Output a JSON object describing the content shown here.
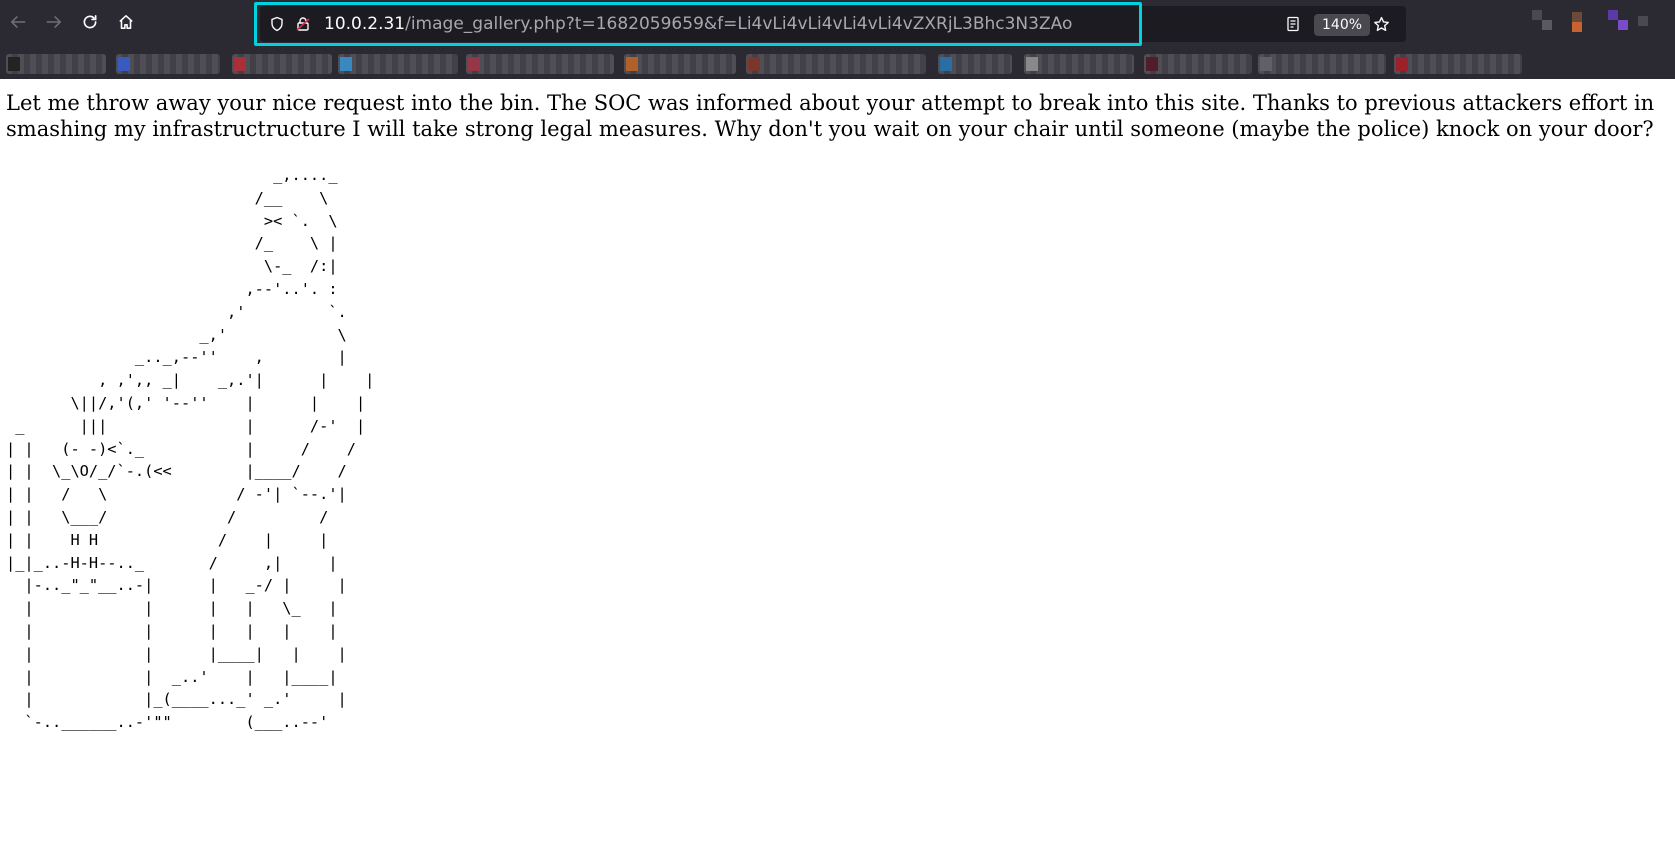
{
  "browser": {
    "url_host": "10.0.2.31",
    "url_path": "/image_gallery.php?t=1682059659&f=Li4vLi4vLi4vLi4vLi4vZXRjL3Bhc3N3ZAo",
    "zoom": "140%"
  },
  "icons": {
    "back": "arrow-left-icon",
    "forward": "arrow-right-icon",
    "reload": "reload-icon",
    "home": "home-icon",
    "shield": "shield-icon",
    "lock": "lock-icon",
    "reader": "reader-view-icon",
    "bookmark": "star-icon"
  },
  "page": {
    "message": "Let me throw away your nice request into the bin. The SOC was informed about your attempt to break into this site. Thanks to previous attackers effort in smashing my infrastructructure I will take strong legal measures. Why don't you wait on your chair until someone (maybe the police) knock on your door?",
    "ascii_art": "                             _,...._\n                           /__    \\\n                            >< `.  \\\n                           /_    \\ |\n                            \\-_  /:|\n                          ,--'..'. :\n                        ,'         `.\n                     _,'            \\\n              _.._,--''    ,        |\n          , ,',, _|    _,.'|      |    |\n       \\||/,'(,' '--''    |      |    |\n _      |||               |      /-'  |\n| |   (- -)<`._           |     /    /\n| |  \\_\\O/_/`-.(<<        |____/    /\n| |   /   \\              / -'| `--.'|\n| |   \\___/             /         /\n| |    H H             /    |     |\n|_|_..-H-H--.._       /     ,|     |\n  |-.._\"_\"__..-|      |   _-/ |     |\n  |            |      |   |   \\_   |\n  |            |      |   |   |    |\n  |            |      |____|   |    |\n  |            |  _..'    |   |____|\n  |            |_(____..._' _.'     |\n  `-..______..-'\"\"        (___..--'"
  },
  "colors": {
    "chrome_bg": "#2b2a33",
    "urlbar_bg": "#1c1b22",
    "focus_ring": "#00d3e0",
    "page_bg": "#ffffff"
  }
}
